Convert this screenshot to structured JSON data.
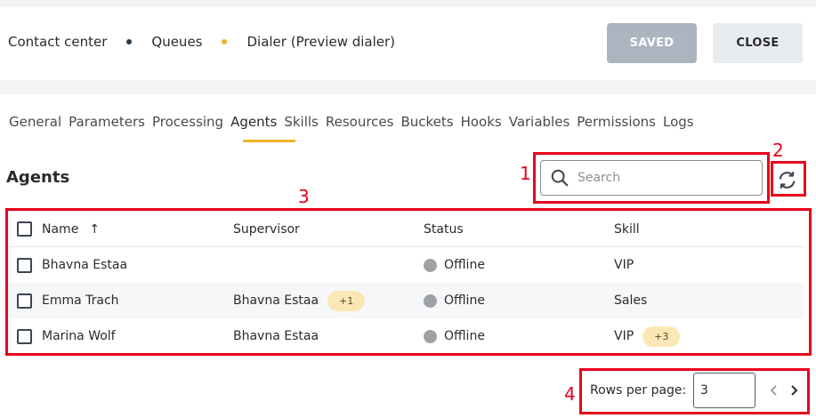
{
  "breadcrumb": {
    "items": [
      "Contact center",
      "Queues",
      "Dialer (Preview dialer)"
    ],
    "dot_colors": [
      "#2b3a4a",
      "#f0b429"
    ]
  },
  "header": {
    "saved_label": "SAVED",
    "close_label": "CLOSE"
  },
  "tabs": [
    "General",
    "Parameters",
    "Processing",
    "Agents",
    "Skills",
    "Resources",
    "Buckets",
    "Hooks",
    "Variables",
    "Permissions",
    "Logs"
  ],
  "active_tab": "Agents",
  "section": {
    "title": "Agents"
  },
  "search": {
    "placeholder": "Search",
    "value": ""
  },
  "table": {
    "columns": [
      "Name",
      "Supervisor",
      "Status",
      "Skill"
    ],
    "sort_indicator": "↑",
    "rows": [
      {
        "name": "Bhavna Estaa",
        "supervisor": "",
        "supervisor_badge": "",
        "status": "Offline",
        "skill": "VIP",
        "skill_badge": ""
      },
      {
        "name": "Emma Trach",
        "supervisor": "Bhavna Estaa",
        "supervisor_badge": "+1",
        "status": "Offline",
        "skill": "Sales",
        "skill_badge": ""
      },
      {
        "name": "Marina Wolf",
        "supervisor": "Bhavna Estaa",
        "supervisor_badge": "",
        "status": "Offline",
        "skill": "VIP",
        "skill_badge": "+3"
      }
    ]
  },
  "pagination": {
    "rows_per_page_label": "Rows per page:",
    "rows_per_page_value": "3"
  },
  "annotations": [
    "1",
    "2",
    "3",
    "4"
  ],
  "colors": {
    "accent": "#f0b429",
    "annotation_red": "#e8001c",
    "saved_button": "#aab5bf",
    "badge_bg": "#fbe7b6",
    "status_offline": "#9ea2a6"
  }
}
